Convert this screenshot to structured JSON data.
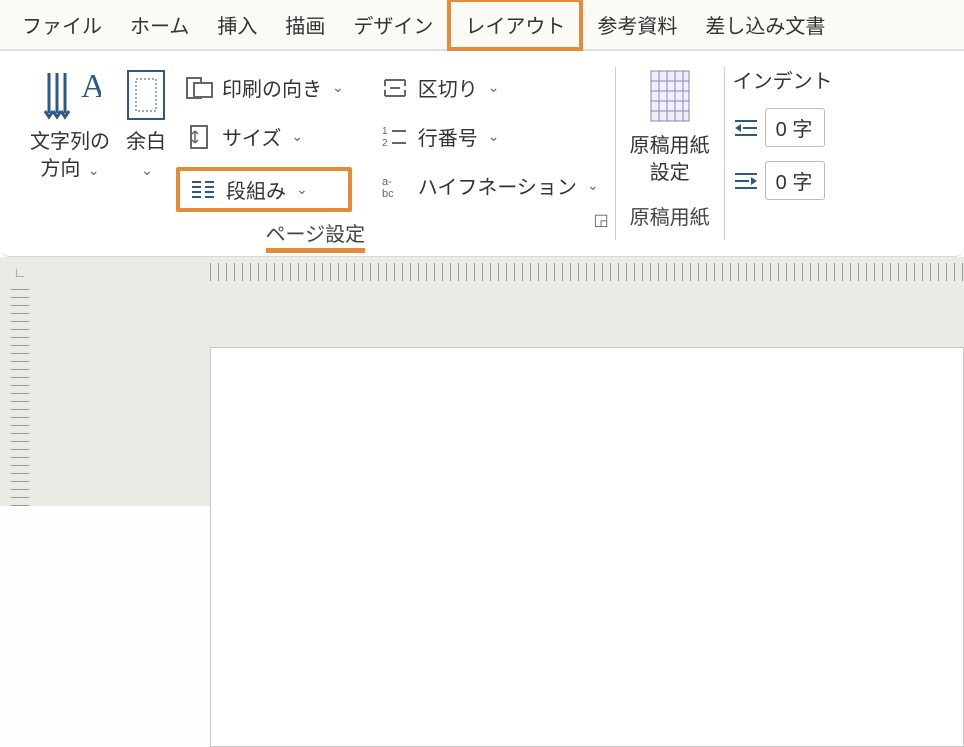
{
  "tabs": {
    "file": "ファイル",
    "home": "ホーム",
    "insert": "挿入",
    "draw": "描画",
    "design": "デザイン",
    "layout": "レイアウト",
    "references": "参考資料",
    "mailings": "差し込み文書"
  },
  "ribbon": {
    "text_direction": {
      "label_line1": "文字列の",
      "label_line2": "方向"
    },
    "margins": {
      "label": "余白"
    },
    "orientation": {
      "label": "印刷の向き"
    },
    "size": {
      "label": "サイズ"
    },
    "columns": {
      "label": "段組み"
    },
    "breaks": {
      "label": "区切り"
    },
    "line_numbers": {
      "label": "行番号"
    },
    "hyphenation": {
      "label": "ハイフネーション"
    },
    "page_setup_group": "ページ設定",
    "manuscript": {
      "label_line1": "原稿用紙",
      "label_line2": "設定"
    },
    "manuscript_group": "原稿用紙",
    "indent": {
      "heading": "インデント",
      "left_value": "0 字",
      "right_value": "0 字"
    }
  }
}
